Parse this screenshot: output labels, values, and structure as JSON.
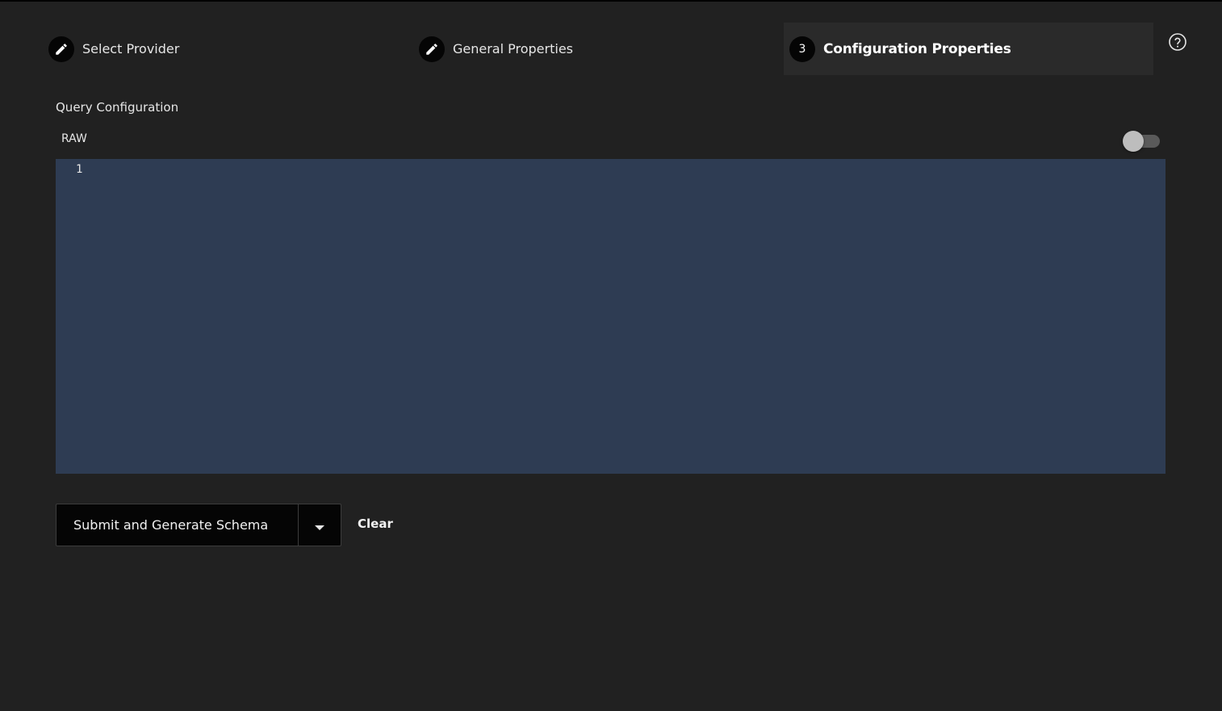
{
  "stepper": {
    "steps": [
      {
        "label": "Select Provider",
        "icon": "pencil-icon",
        "state": "completed"
      },
      {
        "label": "General Properties",
        "icon": "pencil-icon",
        "state": "completed"
      },
      {
        "label": "Configuration Properties",
        "number": "3",
        "state": "active"
      }
    ]
  },
  "help": {
    "icon": "help-circle-icon"
  },
  "section": {
    "title": "Query Configuration",
    "mode_label": "RAW",
    "raw_toggle_on": false
  },
  "editor": {
    "line_numbers": [
      "1"
    ],
    "content": "",
    "background": "#2e3c53"
  },
  "actions": {
    "submit_label": "Submit and Generate Schema",
    "dropdown_icon": "caret-down-icon",
    "clear_label": "Clear"
  },
  "colors": {
    "page_background": "#212121",
    "active_step_background": "#2a2a2a",
    "button_background": "#050505"
  }
}
